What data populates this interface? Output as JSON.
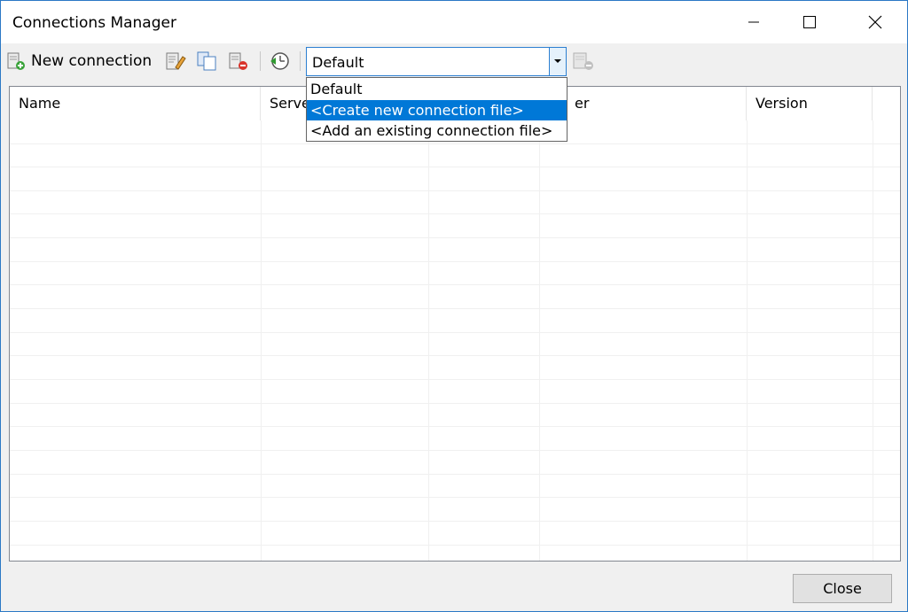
{
  "window": {
    "title": "Connections Manager",
    "controls": [
      "minimize-icon",
      "maximize-icon",
      "close-icon"
    ],
    "accent": "#2b78c5"
  },
  "toolbar": {
    "new_connection_label": "New connection",
    "icons": [
      "new-connection-icon",
      "edit-icon",
      "copy-icon",
      "delete-icon",
      "refresh-clock-icon",
      "connection-file-icon"
    ]
  },
  "connection_file": {
    "selected": "Default",
    "options": [
      "Default",
      "<Create new connection file>",
      "<Add an existing connection file>"
    ],
    "highlighted_index": 1,
    "highlight_color": "#0078d7"
  },
  "table": {
    "columns": [
      "Name",
      "Server",
      "",
      "User",
      "Version"
    ],
    "visible_header_text": [
      "Name",
      "Serve",
      "",
      "er",
      "Version"
    ],
    "rows": []
  },
  "footer": {
    "close_label": "Close"
  }
}
